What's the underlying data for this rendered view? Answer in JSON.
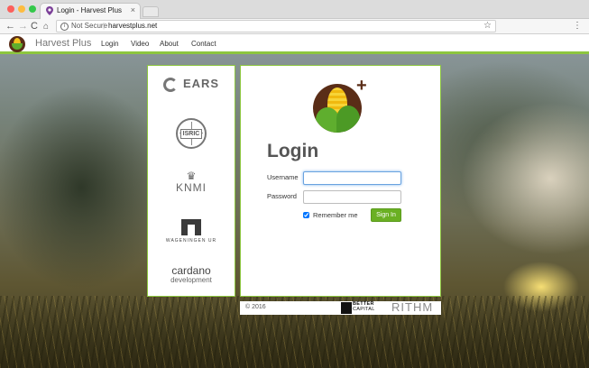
{
  "browser": {
    "tab_title": "Login - Harvest Plus",
    "tab_close": "×",
    "security_label": "Not Secure",
    "url_separator": "|",
    "url": "harvestplus.net",
    "info_icon": "i",
    "back_icon": "←",
    "forward_icon": "→",
    "reload_icon": "C",
    "home_icon": "⌂",
    "star_icon": "☆",
    "menu_icon": "⋮"
  },
  "navbar": {
    "brand": "Harvest Plus",
    "links": [
      "Login",
      "Video",
      "About",
      "Contact"
    ],
    "accent_color": "#8dc63f"
  },
  "partners": {
    "ears": "EARS",
    "isric": "ISRIC",
    "knmi": "KNMI",
    "knmi_crown": "♛",
    "wageningen": "WAGENINGEN UR",
    "cardano": "cardano",
    "cardano_sub": "development"
  },
  "login": {
    "plus": "+",
    "title": "Login",
    "username_label": "Username",
    "username_value": "",
    "password_label": "Password",
    "password_value": "",
    "remember_label": "Remember me",
    "remember_checked": true,
    "signin_label": "Sign In",
    "signin_color": "#6ab023"
  },
  "footer": {
    "copyright": "© 2016",
    "better": "BETTER",
    "capital": "CAPITAL",
    "rithm": "RITHM"
  }
}
